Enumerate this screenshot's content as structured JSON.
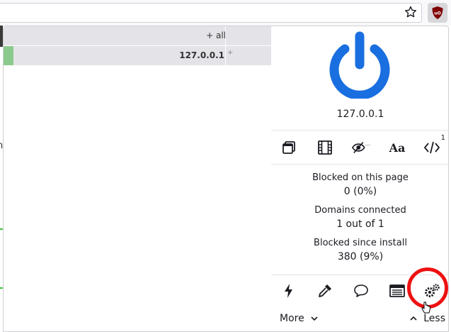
{
  "browser": {
    "icons": {
      "bookmark": "star-icon",
      "extension": "ublock-origin-icon"
    }
  },
  "background_page": {
    "partial_text": "n"
  },
  "firewall": {
    "header_label": "+ all",
    "host_label": "127.0.0.1",
    "host_plus": "+"
  },
  "popup": {
    "hostname": "127.0.0.1",
    "power_color": "#1a6fe0",
    "tools": {
      "cosmetic_badge": "1",
      "names": [
        "no-popups-icon",
        "no-large-media-icon",
        "no-cosmetic-filtering-icon",
        "no-remote-fonts-icon",
        "no-scripting-icon"
      ]
    },
    "stats": {
      "blocked_page_label": "Blocked on this page",
      "blocked_page_value": "0 (0%)",
      "domains_label": "Domains connected",
      "domains_value": "1 out of 1",
      "blocked_install_label": "Blocked since install",
      "blocked_install_value": "380 (9%)"
    },
    "footer": {
      "more_label": "More",
      "less_label": "Less"
    }
  }
}
